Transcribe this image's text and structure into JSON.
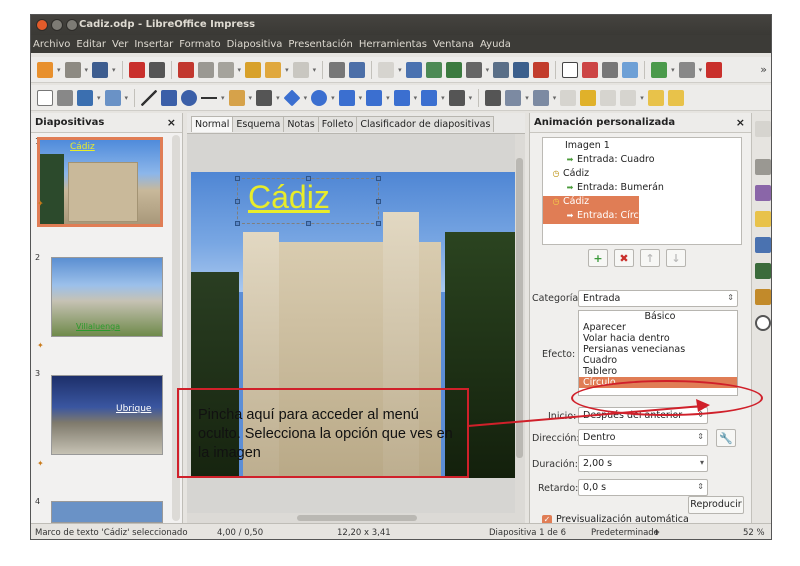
{
  "window": {
    "title": "Cadiz.odp - LibreOffice Impress"
  },
  "menubar": {
    "items": [
      "Archivo",
      "Editar",
      "Ver",
      "Insertar",
      "Formato",
      "Diapositiva",
      "Presentación",
      "Herramientas",
      "Ventana",
      "Ayuda"
    ]
  },
  "slides_pane": {
    "title": "Diapositivas",
    "close": "×",
    "items": [
      {
        "number": "1",
        "caption": "Cádiz"
      },
      {
        "number": "2",
        "caption": "Villaluenga"
      },
      {
        "number": "3",
        "caption": "Ubrique"
      },
      {
        "number": "4",
        "caption": ""
      }
    ]
  },
  "view_tabs": [
    "Normal",
    "Esquema",
    "Notas",
    "Folleto",
    "Clasificador de diapositivas"
  ],
  "slide": {
    "title": "Cádiz"
  },
  "animation_pane": {
    "title": "Animación personalizada",
    "close": "×",
    "effects": [
      {
        "label": "Imagen 1",
        "kind": "object"
      },
      {
        "label": "Entrada: Cuadro",
        "kind": "effect"
      },
      {
        "label": "Cádiz",
        "kind": "object"
      },
      {
        "label": "Entrada: Bumerán",
        "kind": "effect"
      },
      {
        "label": "Cádiz",
        "kind": "object"
      },
      {
        "label": "Entrada: Círculo",
        "kind": "effect"
      }
    ],
    "categoria_label": "Categoría:",
    "categoria_value": "Entrada",
    "efecto_label": "Efecto:",
    "efecto_group": "Básico",
    "efecto_options": [
      "Aparecer",
      "Volar hacia dentro",
      "Persianas venecianas",
      "Cuadro",
      "Tablero",
      "Círculo"
    ],
    "efecto_selected": "Círculo",
    "inicio_label": "Inicio:",
    "inicio_value": "Después del anterior",
    "direccion_label": "Dirección:",
    "direccion_value": "Dentro",
    "duracion_label": "Duración:",
    "duracion_value": "2,00 s",
    "retardo_label": "Retardo:",
    "retardo_value": "0,0 s",
    "preview_label": "Previsualización automática",
    "play_label": "Reproducir"
  },
  "status": {
    "selection": "Marco de texto 'Cádiz' seleccionado",
    "position": "4,00 / 0,50",
    "size": "12,20 x 3,41",
    "slide": "Diapositiva 1 de 6",
    "master": "Predeterminado",
    "zoom": "52 %"
  },
  "annotation": {
    "callout_text": "Pincha aquí para acceder al menú oculto. Selecciona la opción que ves en la imagen"
  },
  "colors": {
    "selection": "#e07d55",
    "annotation": "#d0202a",
    "title_yellow": "#e8ec2a"
  }
}
